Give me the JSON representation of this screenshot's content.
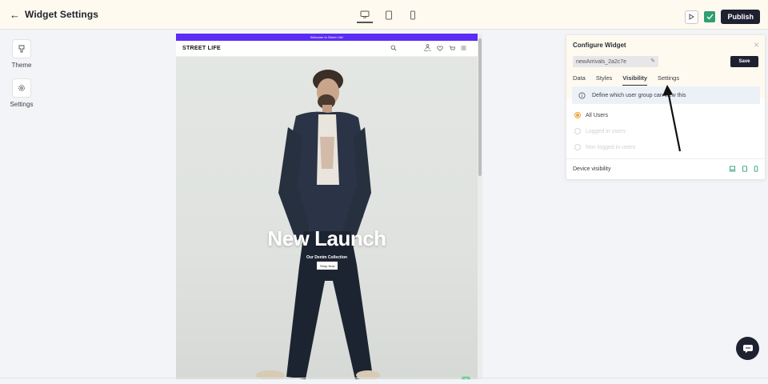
{
  "header": {
    "back_icon": "arrow-left-icon",
    "title": "Widget Settings",
    "publish_label": "Publish"
  },
  "devices": [
    "desktop-icon",
    "tablet-icon",
    "mobile-icon"
  ],
  "sidebar": {
    "items": [
      {
        "label": "Theme",
        "icon": "brush-icon"
      },
      {
        "label": "Settings",
        "icon": "gear-icon"
      }
    ]
  },
  "preview": {
    "announcement": "Welcome to Street Life!",
    "brand": "STREET LIFE",
    "nav_signin": "Sign In",
    "hero_title": "New Launch",
    "hero_subtitle": "Our Denim Collection",
    "cta": "Shop Now"
  },
  "panel": {
    "title": "Configure Widget",
    "widget_name": "newArrivals_2a2c7e",
    "save_label": "Save",
    "tabs": [
      "Data",
      "Styles",
      "Visibility",
      "Settings"
    ],
    "active_tab": "Visibility",
    "info_text": "Define which user group can view this",
    "options": [
      {
        "label": "All Users",
        "selected": true
      },
      {
        "label": "Logged in users",
        "selected": false
      },
      {
        "label": "Non logged in users",
        "selected": false
      }
    ],
    "device_visibility_label": "Device visibility"
  },
  "colors": {
    "accent": "#5b2cf5",
    "dark": "#1e2130",
    "radio": "#f0a030",
    "green": "#2f9e72"
  }
}
